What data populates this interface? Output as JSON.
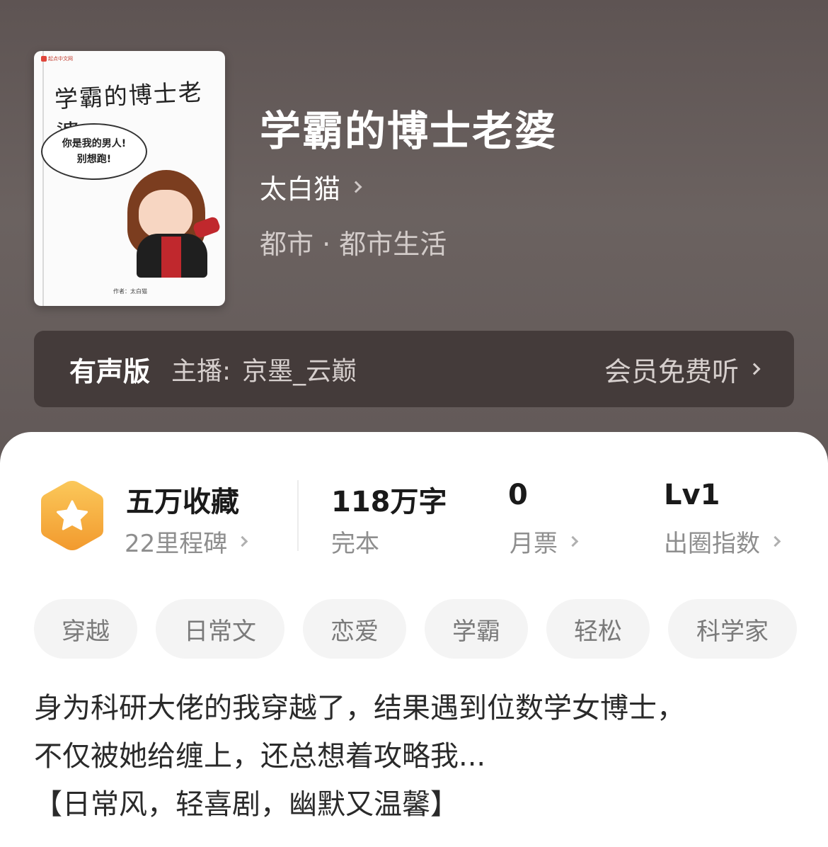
{
  "book": {
    "title": "学霸的博士老婆",
    "author": "太白猫",
    "genre": "都市 · 都市生活"
  },
  "cover": {
    "brand": "起点中文网",
    "title": "学霸的博士老婆",
    "bubble_line1": "你是我的男人!",
    "bubble_line2": "别想跑!",
    "author_credit": "作者：太白猫"
  },
  "audio": {
    "label": "有声版",
    "anchor_prefix": "主播:",
    "anchor_name": "京墨_云巅",
    "action": "会员免费听"
  },
  "stats": {
    "collection": {
      "value": "五万收藏",
      "sub": "22里程碑"
    },
    "words": {
      "value": "118万字",
      "sub": "完本"
    },
    "monthly": {
      "value": "0",
      "sub": "月票"
    },
    "level": {
      "value": "Lv1",
      "sub": "出圈指数"
    }
  },
  "tags": [
    "穿越",
    "日常文",
    "恋爱",
    "学霸",
    "轻松",
    "科学家"
  ],
  "description": {
    "line1": "身为科研大佬的我穿越了，结果遇到位数学女博士，",
    "line2": "不仅被她给缠上，还总想着攻略我...",
    "line3": "【日常风，轻喜剧，幽默又温馨】"
  },
  "colors": {
    "header_bg": "#5e5453",
    "badge_gradient_top": "#fbc85a",
    "badge_gradient_bottom": "#f29a2e",
    "tag_bg": "#f4f4f4"
  },
  "icons": {
    "badge": "star-hexagon-icon",
    "chevron": "chevron-right-icon"
  }
}
